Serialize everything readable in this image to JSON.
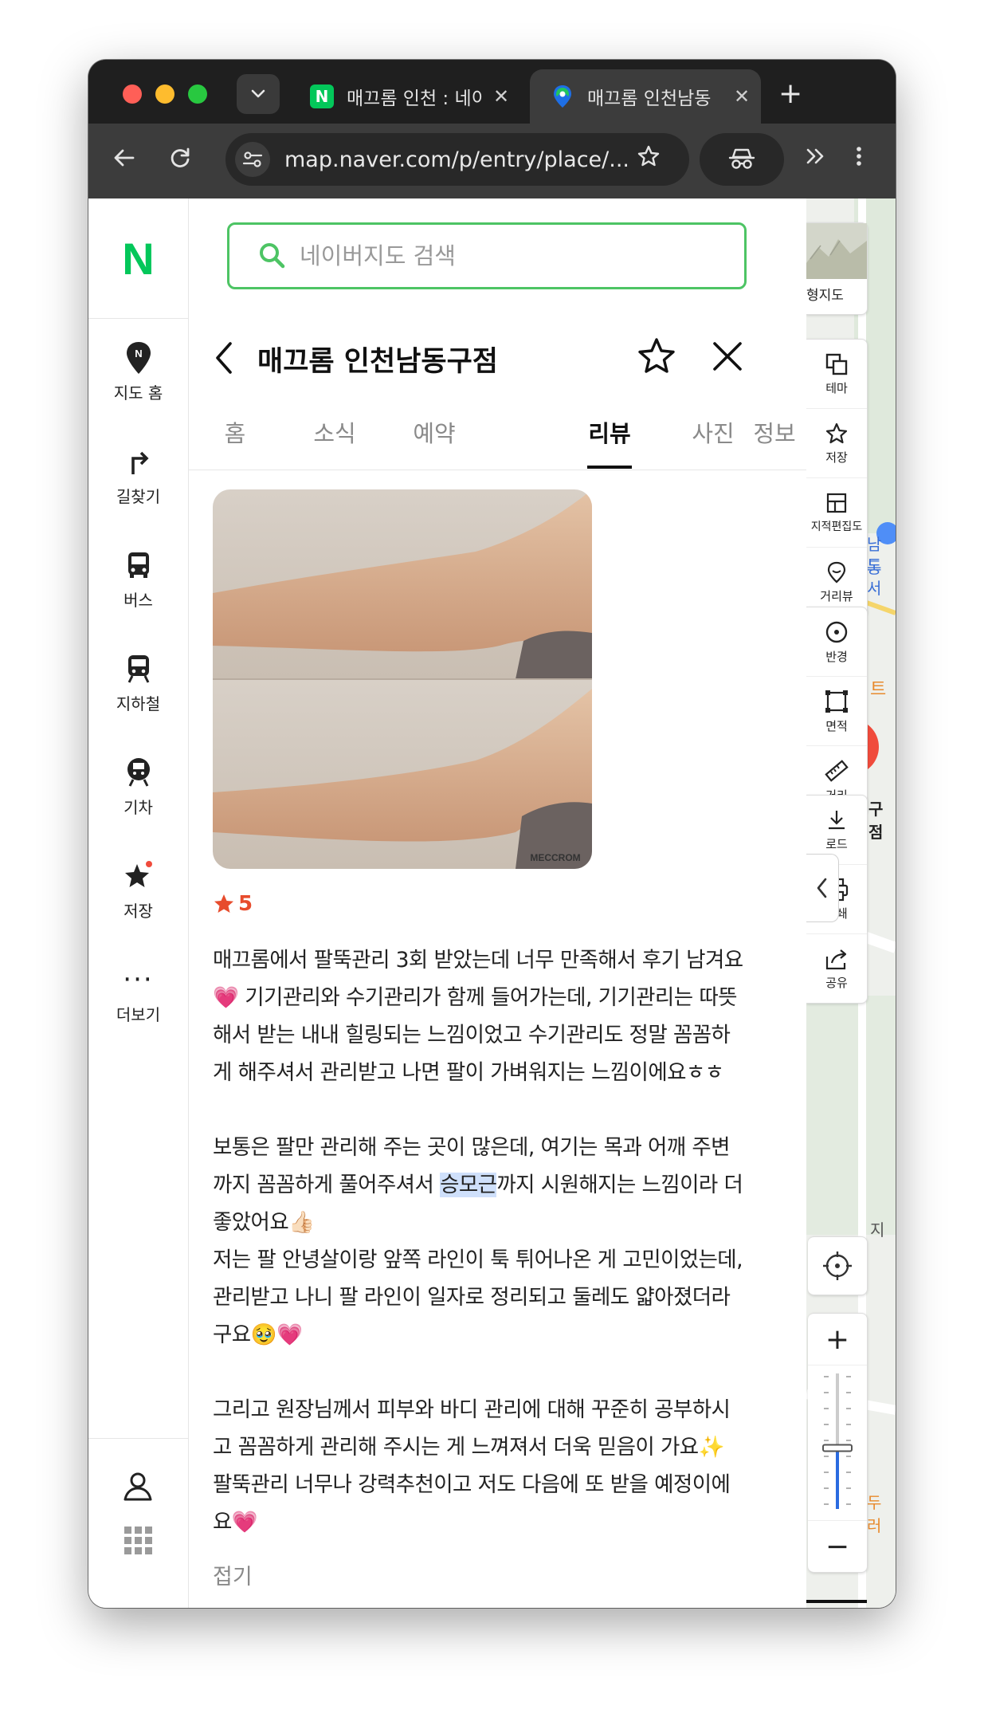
{
  "browser": {
    "tabs": [
      {
        "title": "매끄롬 인천 : 네이",
        "favicon": "naver-n-icon",
        "favicon_letter": "N",
        "active": false
      },
      {
        "title": "매끄롬 인천남동",
        "favicon": "naver-map-pin-icon",
        "active": true
      }
    ],
    "url": "map.naver.com/p/entry/place/..."
  },
  "left_nav": {
    "logo": "N",
    "items": [
      {
        "label": "지도 홈",
        "icon": "map-pin-icon"
      },
      {
        "label": "길찾기",
        "icon": "turn-right-arrow-icon"
      },
      {
        "label": "버스",
        "icon": "bus-icon"
      },
      {
        "label": "지하철",
        "icon": "subway-icon"
      },
      {
        "label": "기차",
        "icon": "train-icon"
      },
      {
        "label": "저장",
        "icon": "star-icon"
      },
      {
        "label": "더보기",
        "icon": "more-dots-icon",
        "glyph": "···"
      }
    ]
  },
  "search": {
    "placeholder": "네이버지도 검색"
  },
  "place": {
    "title": "매끄롬 인천남동구점",
    "tabs": [
      "홈",
      "소식",
      "예약",
      "리뷰",
      "사진",
      "정보"
    ],
    "active_tab": "리뷰"
  },
  "review": {
    "image_watermark": "MECCROM",
    "rating": "5",
    "paragraph1": "매끄롬에서 팔뚝관리 3회 받았는데 너무 만족해서 후기 남겨요\n💗 기기관리와 수기관리가 함께 들어가는데, 기기관리는 따뜻\n해서 받는 내내 힐링되는 느낌이었고 수기관리도 정말 꼼꼼하\n게 해주셔서 관리받고 나면 팔이 가벼워지는 느낌이에요ㅎㅎ",
    "paragraph2_before": "보통은 팔만 관리해 주는 곳이 많은데, 여기는 목과 어깨 주변\n까지 꼼꼼하게 풀어주셔서 ",
    "paragraph2_highlight": "승모근",
    "paragraph2_after": "까지 시원해지는 느낌이라 더\n좋았어요👍🏻\n저는 팔 안녕살이랑 앞쪽 라인이 툭 튀어나온 게 고민이었는데,\n관리받고 나니 팔 라인이 일자로 정리되고 둘레도 얇아졌더라\n구요🥹💗",
    "paragraph3": "그리고 원장님께서 피부와 바디 관리에 대해 꾸준히 공부하시\n고 꼼꼼하게 관리해 주시는 게 느껴져서 더욱 믿음이 가요✨\n팔뚝관리 너무나 강력추천이고 저도 다음에 또 받을 예정이에\n요💗",
    "fold_label": "접기"
  },
  "map_tools": {
    "terrain": "형지도",
    "group1": [
      {
        "label": "테마",
        "icon": "theme-layers-icon"
      },
      {
        "label": "저장",
        "icon": "star-outline-icon"
      },
      {
        "label": "지적편집도",
        "icon": "cadastral-map-icon"
      },
      {
        "label": "거리뷰",
        "icon": "street-view-pin-icon"
      }
    ],
    "group2": [
      {
        "label": "반경",
        "icon": "radius-icon"
      },
      {
        "label": "면적",
        "icon": "area-icon"
      },
      {
        "label": "거리",
        "icon": "ruler-icon"
      }
    ],
    "group3": [
      {
        "label": "로드",
        "icon": "download-icon"
      },
      {
        "label": "인쇄",
        "icon": "print-icon"
      },
      {
        "label": "공유",
        "icon": "share-icon"
      }
    ],
    "zoom_in": "+",
    "zoom_out": "−",
    "zoom_level": 0.45,
    "map_labels": [
      "남동",
      "도서",
      "트",
      "구점",
      "지",
      "두러"
    ]
  }
}
